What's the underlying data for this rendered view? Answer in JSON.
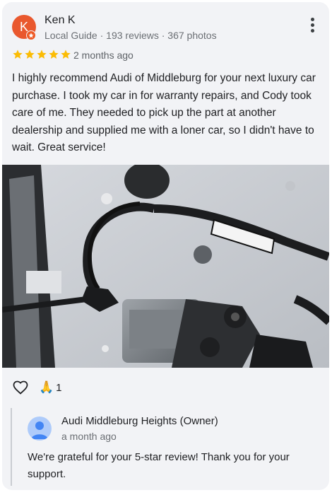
{
  "review": {
    "author": {
      "name": "Ken K",
      "initial": "K"
    },
    "meta": "Local Guide · 193 reviews · 367 photos",
    "rating": 5,
    "time": "2 months ago",
    "text": "I highly recommend Audi of Middleburg for your next luxury car purchase. I took my car in for warranty repairs, and Cody took care of me. They needed to pick up the part at another dealership and supplied me with a loner car, so I didn't have to wait. Great service!",
    "reactions": {
      "pray_emoji": "🙏",
      "pray_count": "1"
    }
  },
  "owner_reply": {
    "name": "Audi Middleburg Heights (Owner)",
    "time": "a month ago",
    "text": "We're grateful for your 5-star review! Thank you for your support."
  },
  "colors": {
    "avatar": "#e9582e",
    "star": "#fbbc04",
    "owner_avatar": "#aecbfa",
    "owner_icon": "#4285f4"
  }
}
